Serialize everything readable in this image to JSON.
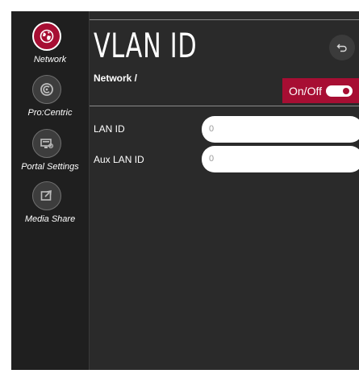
{
  "sidebar": {
    "items": [
      {
        "label": "Network",
        "icon": "globe-icon",
        "active": true
      },
      {
        "label": "Pro:Centric",
        "icon": "procentric-icon",
        "active": false
      },
      {
        "label": "Portal Settings",
        "icon": "portal-settings-icon",
        "active": false
      },
      {
        "label": "Media Share",
        "icon": "media-share-icon",
        "active": false
      }
    ]
  },
  "header": {
    "title": "VLAN ID",
    "breadcrumb": "Network /",
    "back_icon": "back-arrow-icon"
  },
  "toggle": {
    "label": "On/Off",
    "state": "on"
  },
  "fields": [
    {
      "label": "LAN ID",
      "value": "0"
    },
    {
      "label": "Aux LAN ID",
      "value": "0"
    }
  ],
  "colors": {
    "accent": "#a70e33",
    "background": "#2a2a2a",
    "sidebar": "#1f1f1f"
  }
}
